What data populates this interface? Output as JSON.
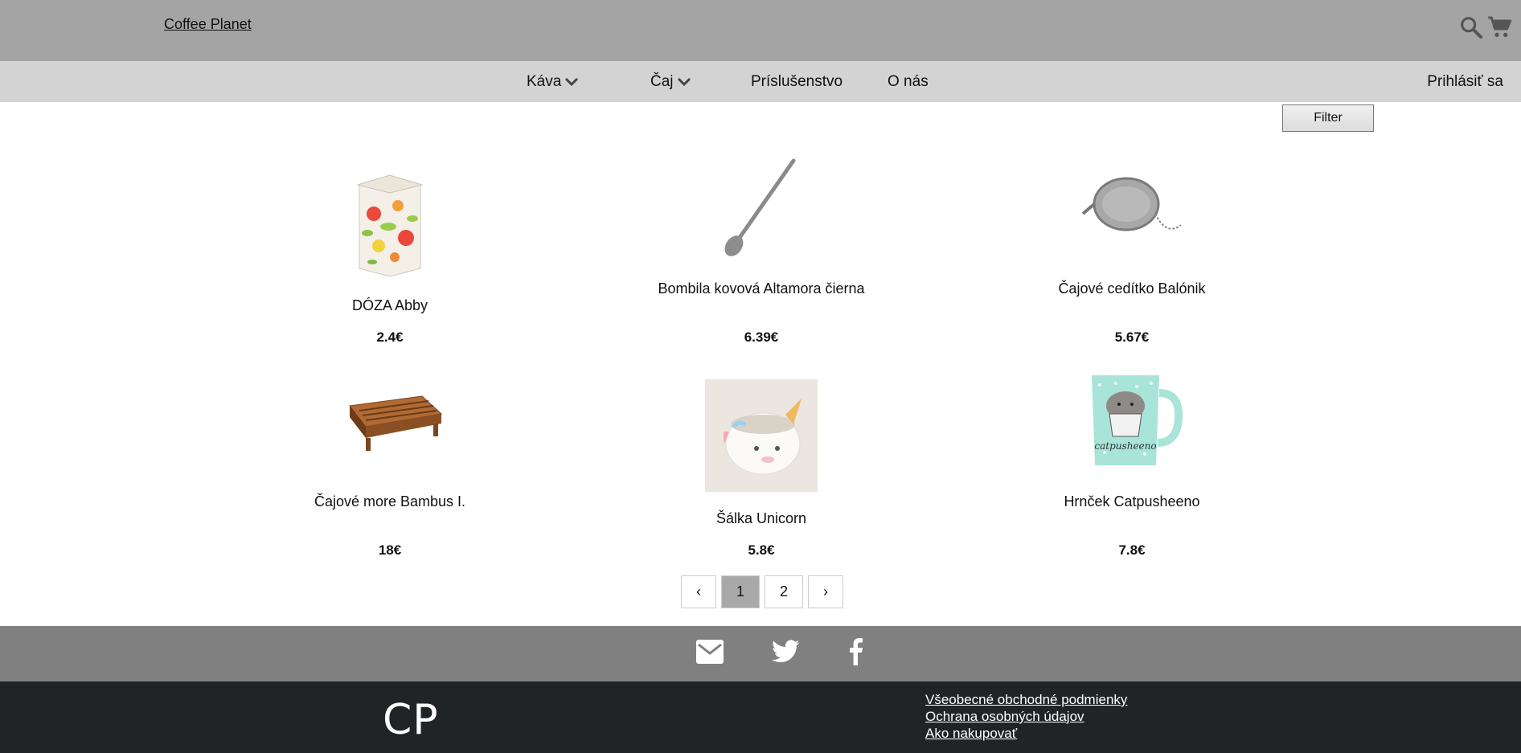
{
  "header": {
    "brand": "Coffee Planet",
    "icons": [
      "search-icon",
      "cart-icon"
    ]
  },
  "nav": {
    "items": [
      {
        "label": "Káva",
        "has_dropdown": true
      },
      {
        "label": "Čaj",
        "has_dropdown": true
      },
      {
        "label": "Príslušenstvo",
        "has_dropdown": false
      },
      {
        "label": "O nás",
        "has_dropdown": false
      }
    ],
    "login": "Prihlásiť sa"
  },
  "filter": {
    "label": "Filter"
  },
  "products": [
    {
      "name": "DÓZA Abby",
      "price": "2.4€"
    },
    {
      "name": "Bombila kovová Altamora čierna",
      "price": "6.39€"
    },
    {
      "name": "Čajové cedítko Balónik",
      "price": "5.67€"
    },
    {
      "name": "Čajové more Bambus I.",
      "price": "18€"
    },
    {
      "name": "Šálka Unicorn",
      "price": "5.8€"
    },
    {
      "name": "Hrnček Catpusheeno",
      "price": "7.8€"
    }
  ],
  "pagination": {
    "prev": "‹",
    "pages": [
      "1",
      "2"
    ],
    "current": "1",
    "next": "›"
  },
  "social": {
    "icons": [
      "mail-icon",
      "twitter-icon",
      "facebook-icon"
    ]
  },
  "footer": {
    "logo": "CP",
    "links": [
      "Všeobecné obchodné podmienky",
      "Ochrana osobných údajov",
      "Ako nakupovať"
    ]
  },
  "colors": {
    "topbar": "#a4a4a4",
    "navbar": "#d3d3d3",
    "social_bar": "#808080",
    "footer": "#212427",
    "active_page": "#a9a9a9"
  }
}
